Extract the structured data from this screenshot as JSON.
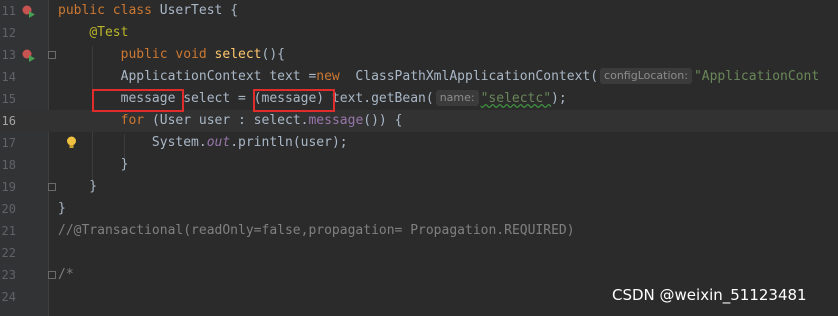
{
  "editor": {
    "lines": [
      {
        "num": "11",
        "tokens": [
          [
            "kw",
            "public class "
          ],
          [
            "t",
            "UserTest {"
          ]
        ]
      },
      {
        "num": "12",
        "tokens": [
          [
            "t",
            "    "
          ],
          [
            "ann",
            "@Test"
          ]
        ]
      },
      {
        "num": "13",
        "tokens": [
          [
            "t",
            "        "
          ],
          [
            "kw",
            "public void "
          ],
          [
            "meth",
            "select"
          ],
          [
            "t",
            "(){"
          ]
        ]
      },
      {
        "num": "14",
        "tokens": [
          [
            "t",
            "        ApplicationContext text ="
          ],
          [
            "kw",
            "new "
          ],
          [
            "t",
            " ClassPathXmlApplicationContext("
          ],
          [
            "hint",
            "configLocation:"
          ],
          [
            "str",
            "\"ApplicationCont"
          ]
        ]
      },
      {
        "num": "15",
        "tokens": [
          [
            "t",
            "        message select = (message) text.getBean("
          ],
          [
            "hint",
            "name:"
          ],
          [
            "sq",
            "\"selectc\""
          ],
          [
            "t",
            ");"
          ]
        ]
      },
      {
        "num": "16",
        "tokens": [
          [
            "t",
            "        "
          ],
          [
            "kw",
            "for "
          ],
          [
            "t",
            "(User user : select."
          ],
          [
            "fld",
            "message"
          ],
          [
            "t",
            "()) {"
          ]
        ]
      },
      {
        "num": "17",
        "tokens": [
          [
            "t",
            "            System."
          ],
          [
            "stat",
            "out"
          ],
          [
            "t",
            ".println(user);"
          ]
        ]
      },
      {
        "num": "18",
        "tokens": [
          [
            "t",
            "        }"
          ]
        ]
      },
      {
        "num": "19",
        "tokens": [
          [
            "t",
            "    }"
          ]
        ]
      },
      {
        "num": "20",
        "tokens": [
          [
            "t",
            "}"
          ]
        ]
      },
      {
        "num": "21",
        "tokens": [
          [
            "cmt",
            "//@Transactional(readOnly=false,propagation= Propagation.REQUIRED)"
          ]
        ]
      },
      {
        "num": "22",
        "tokens": []
      },
      {
        "num": "23",
        "tokens": [
          [
            "cmt",
            "/*"
          ]
        ]
      },
      {
        "num": "24",
        "tokens": []
      }
    ],
    "current_line": "16"
  },
  "watermark": "CSDN @weixin_51123481",
  "colors": {
    "background": "#2b2b2b",
    "keyword": "#cc7832",
    "annotation": "#bbb529",
    "string": "#6a8759",
    "highlight_box": "#e22b2b"
  },
  "icons": [
    "run-breakpoint-icon",
    "fold-icon",
    "lightbulb-icon"
  ]
}
